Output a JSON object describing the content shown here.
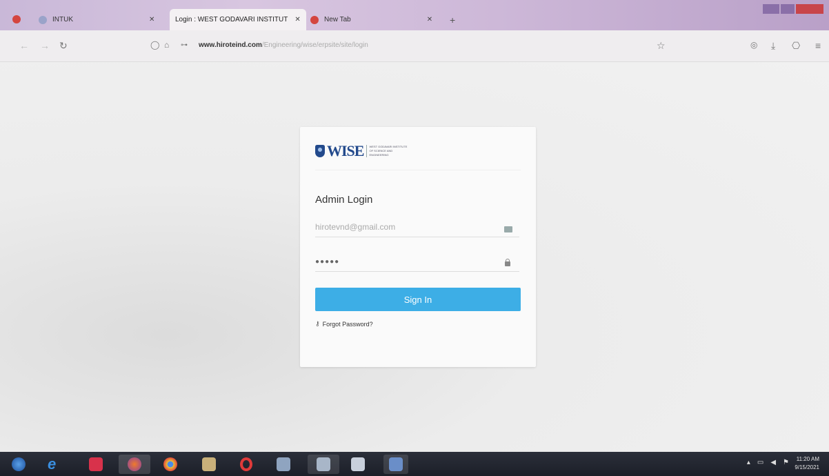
{
  "browser": {
    "tabs": [
      {
        "label": "INTUK",
        "active": false
      },
      {
        "label": "Login : WEST GODAVARI INSTITUT",
        "active": true
      },
      {
        "label": "New Tab",
        "active": false
      }
    ],
    "close_glyph": "✕",
    "new_tab_glyph": "+",
    "url_host": "www.hiroteind.com",
    "url_path": "/Engineering/wise/erpsite/site/login"
  },
  "login": {
    "logo_text": "WISE",
    "logo_subtext": "WEST GODAVARI INSTITUTE OF SCIENCE AND ENGINEERING",
    "title": "Admin Login",
    "email_value": "hirotevnd@gmail.com",
    "password_value": "●●●●●",
    "signin_label": "Sign In",
    "forgot_label": "Forgot Password?"
  },
  "taskbar": {
    "time": "11:20 AM",
    "date": "9/15/2021"
  },
  "colors": {
    "accent": "#3daee6",
    "logo": "#234a8c"
  }
}
